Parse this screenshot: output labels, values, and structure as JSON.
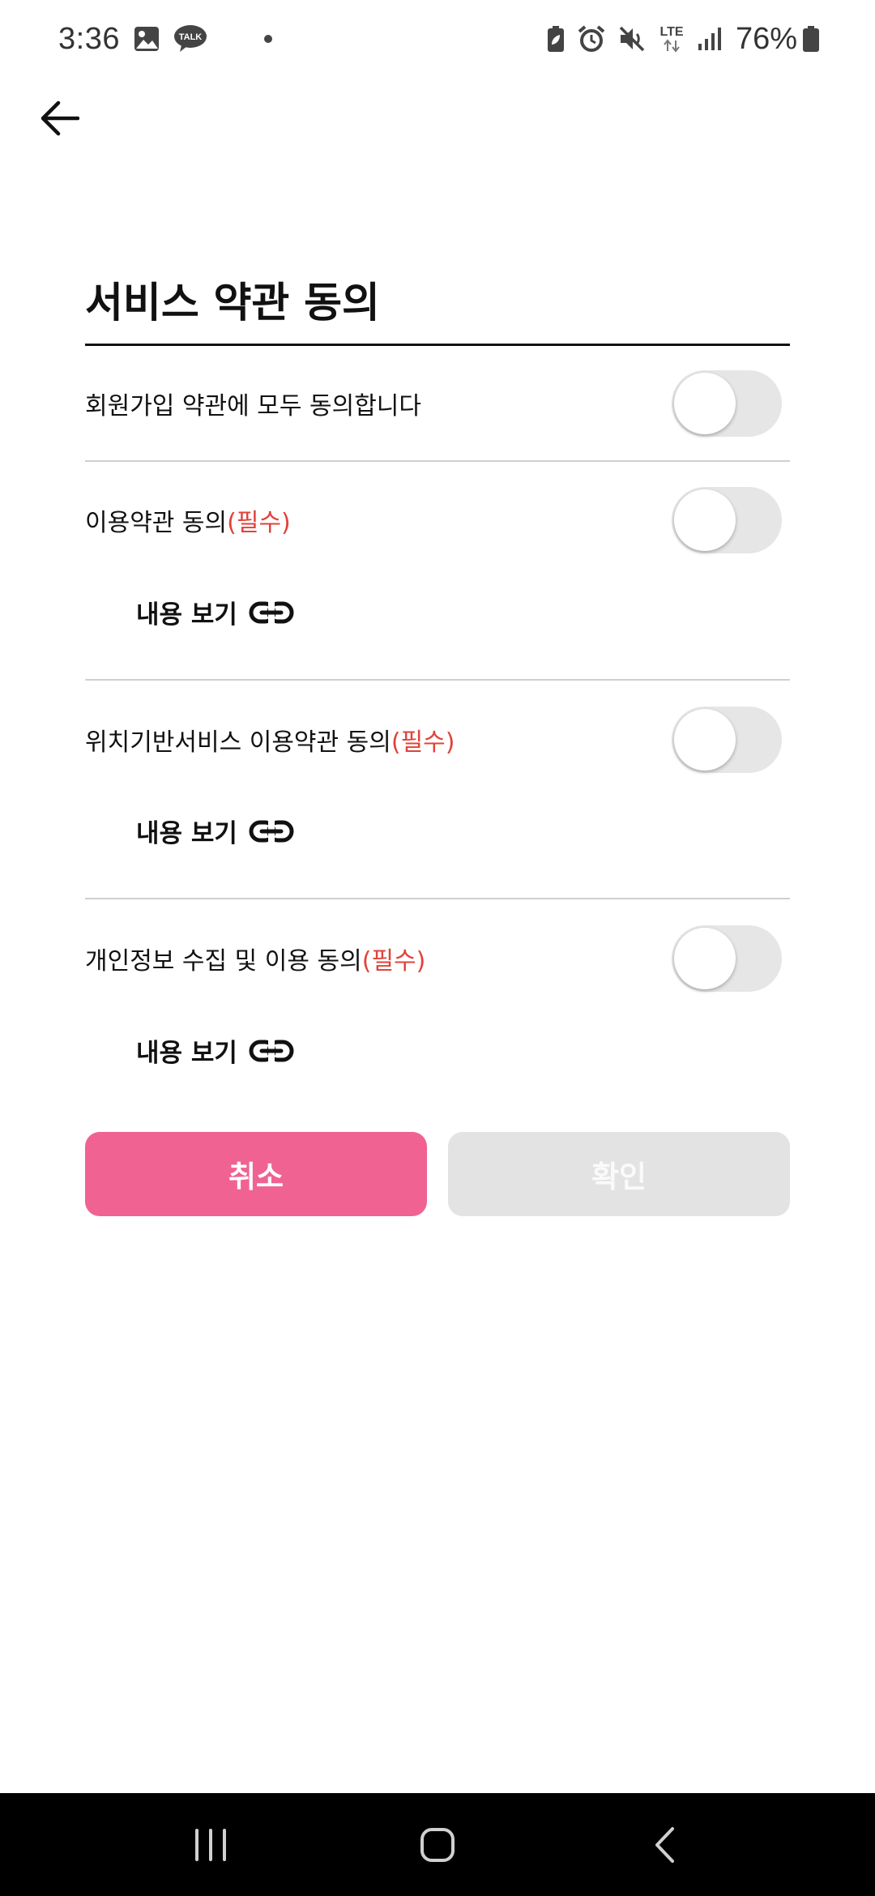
{
  "status_bar": {
    "time": "3:36",
    "talk_badge": "TALK",
    "lte": "LTE",
    "battery": "76%"
  },
  "page": {
    "title": "서비스 약관 동의"
  },
  "all_agree": {
    "label": "회원가입 약관에 모두 동의합니다",
    "on": false
  },
  "terms": [
    {
      "label": "이용약관 동의",
      "required": "(필수)",
      "view_label": "내용 보기",
      "on": false
    },
    {
      "label": "위치기반서비스 이용약관 동의",
      "required": "(필수)",
      "view_label": "내용 보기",
      "on": false
    },
    {
      "label": "개인정보 수집 및 이용 동의",
      "required": "(필수)",
      "view_label": "내용 보기",
      "on": false
    }
  ],
  "buttons": {
    "cancel": "취소",
    "confirm": "확인"
  },
  "colors": {
    "accent": "#f06292",
    "required": "#e0433a",
    "disabled": "#e3e3e3"
  }
}
